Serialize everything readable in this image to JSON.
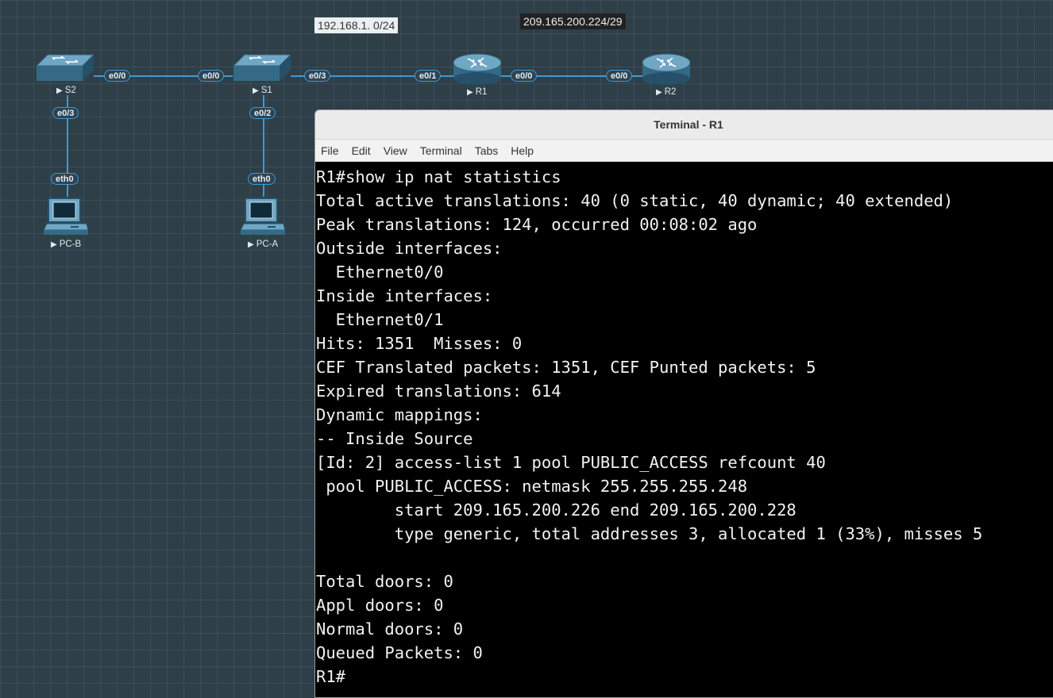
{
  "topology": {
    "networks": [
      {
        "label": "192.168.1. 0/24",
        "bg": "#eceff1",
        "fg": "#333333"
      },
      {
        "label": "209.165.200.224/29",
        "bg": "#222222",
        "fg": "#eeeeee"
      }
    ],
    "devices": {
      "S2": "S2",
      "S1": "S1",
      "R1": "R1",
      "R2": "R2",
      "PCB": "PC-B",
      "PCA": "PC-A"
    },
    "ports": {
      "s2_e00": "e0/0",
      "s1_e00": "e0/0",
      "s1_e03": "e0/3",
      "r1_e01": "e0/1",
      "r1_e00": "e0/0",
      "r2_e00": "e0/0",
      "s2_e03": "e0/3",
      "s1_e02": "e0/2",
      "pcb_eth0": "eth0",
      "pca_eth0": "eth0"
    },
    "link_color": "#3d9ad6"
  },
  "terminal": {
    "title": "Terminal - R1",
    "menu": [
      "File",
      "Edit",
      "View",
      "Terminal",
      "Tabs",
      "Help"
    ],
    "lines": [
      "R1#show ip nat statistics",
      "Total active translations: 40 (0 static, 40 dynamic; 40 extended)",
      "Peak translations: 124, occurred 00:08:02 ago",
      "Outside interfaces:",
      "  Ethernet0/0",
      "Inside interfaces:",
      "  Ethernet0/1",
      "Hits: 1351  Misses: 0",
      "CEF Translated packets: 1351, CEF Punted packets: 5",
      "Expired translations: 614",
      "Dynamic mappings:",
      "-- Inside Source",
      "[Id: 2] access-list 1 pool PUBLIC_ACCESS refcount 40",
      " pool PUBLIC_ACCESS: netmask 255.255.255.248",
      "        start 209.165.200.226 end 209.165.200.228",
      "        type generic, total addresses 3, allocated 1 (33%), misses 5",
      "",
      "Total doors: 0",
      "Appl doors: 0",
      "Normal doors: 0",
      "Queued Packets: 0",
      "R1#"
    ]
  }
}
